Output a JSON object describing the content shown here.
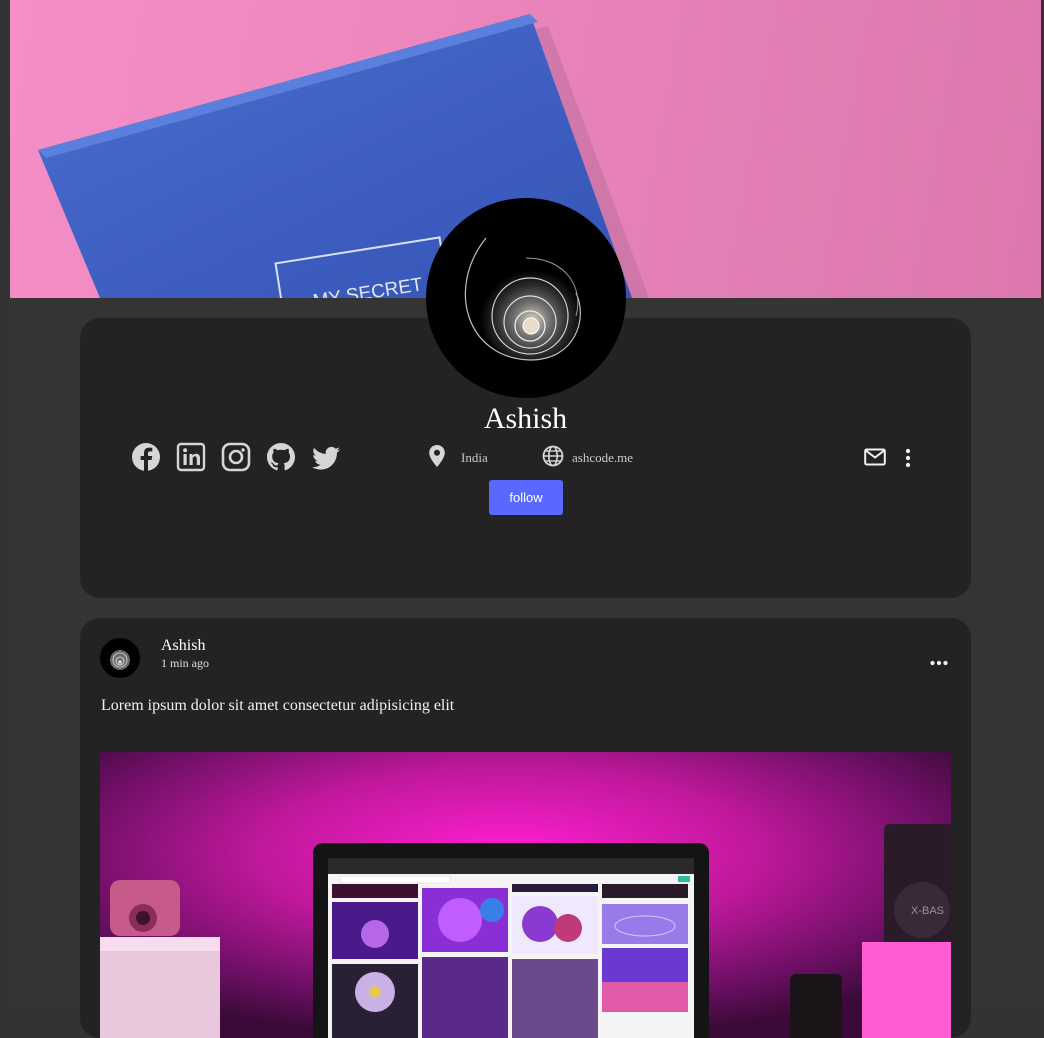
{
  "cover": {
    "book_text": "MY SECRET",
    "colors": {
      "background": "#f090c3",
      "book": "#3d5fc4"
    }
  },
  "profile": {
    "name": "Ashish",
    "location": "India",
    "website": "ashcode.me",
    "follow_label": "follow",
    "socials": [
      {
        "icon": "facebook-icon"
      },
      {
        "icon": "linkedin-icon"
      },
      {
        "icon": "instagram-icon"
      },
      {
        "icon": "github-icon"
      },
      {
        "icon": "twitter-icon"
      }
    ],
    "accent_color": "#5a68ff"
  },
  "post": {
    "author": "Ashish",
    "time": "1 min ago",
    "text": "Lorem ipsum dolor sit amet consectetur adipisicing elit"
  }
}
